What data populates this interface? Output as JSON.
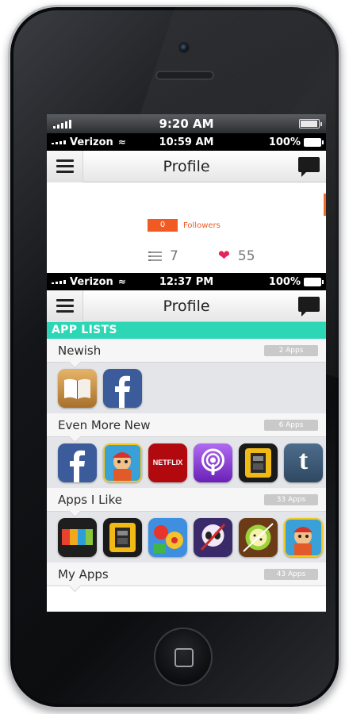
{
  "outer_status": {
    "time": "9:20 AM"
  },
  "screen1": {
    "status": {
      "carrier": "Verizon",
      "time": "10:59 AM",
      "battery": "100%"
    },
    "nav": {
      "title": "Profile"
    },
    "followers": {
      "count": "0",
      "label": "Followers"
    },
    "stats": {
      "lists": "7",
      "likes": "55"
    }
  },
  "screen2": {
    "status": {
      "carrier": "Verizon",
      "time": "12:37 PM",
      "battery": "100%"
    },
    "nav": {
      "title": "Profile"
    },
    "section_title": "APP LISTS",
    "lists": [
      {
        "name": "Newish",
        "count": "2 Apps",
        "icons": [
          "ibooks-icon",
          "facebook-icon"
        ]
      },
      {
        "name": "Even More New",
        "count": "6 Apps",
        "icons": [
          "facebook-icon",
          "subway-surfers-icon",
          "netflix-icon",
          "podcasts-icon",
          "robot-game-icon",
          "tumblr-icon"
        ]
      },
      {
        "name": "Apps I Like",
        "count": "33 Apps",
        "icons": [
          "color-blocks-icon",
          "robot-game-icon",
          "puzzle-game-icon",
          "ninja-game-icon",
          "fruit-ninja-icon",
          "subway-surfers-icon"
        ]
      },
      {
        "name": "My Apps",
        "count": "43 Apps",
        "icons": []
      }
    ],
    "netflix_text": "NETFLIX",
    "tumblr_text": "t"
  },
  "colors": {
    "accent_teal": "#2dd6b5",
    "accent_orange": "#f25a23",
    "heart": "#e8215a"
  }
}
